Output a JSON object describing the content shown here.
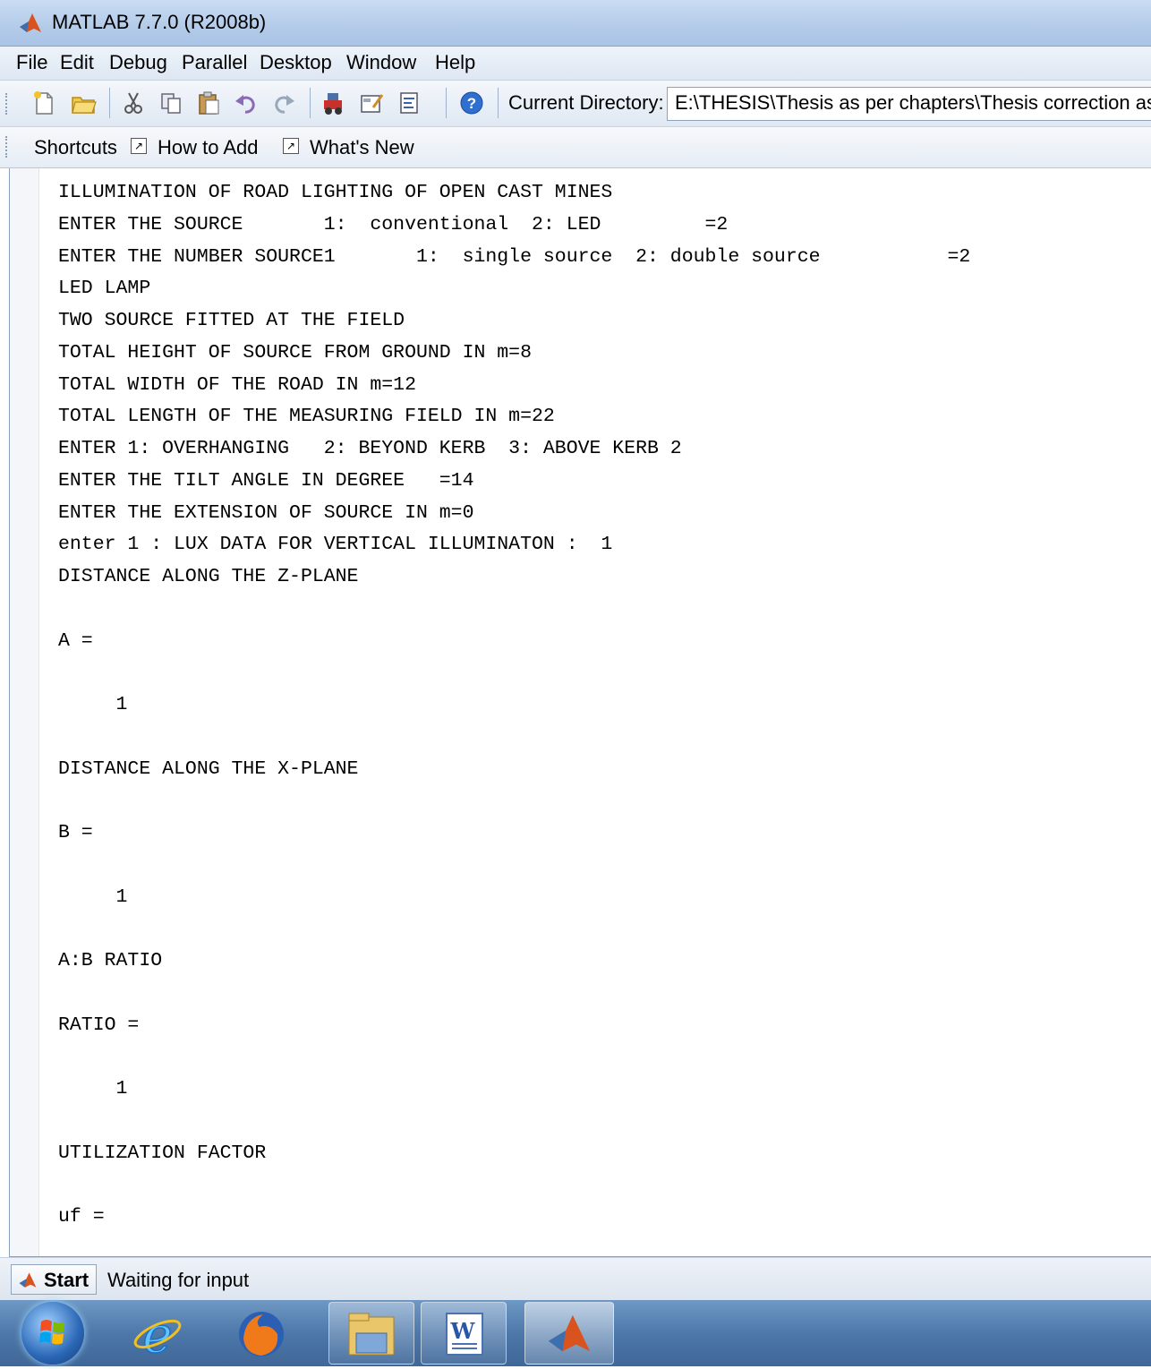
{
  "window": {
    "title": "MATLAB 7.7.0 (R2008b)"
  },
  "menu": [
    "File",
    "Edit",
    "Debug",
    "Parallel",
    "Desktop",
    "Window",
    "Help"
  ],
  "toolbar": {
    "current_directory_label": "Current Directory:",
    "current_directory_value": "E:\\THESIS\\Thesis as per chapters\\Thesis correction as"
  },
  "shortcuts": {
    "label": "Shortcuts",
    "how_to_add": "How to Add",
    "whats_new": "What's New"
  },
  "command_window": {
    "lines": [
      "ILLUMINATION OF ROAD LIGHTING OF OPEN CAST MINES",
      "ENTER THE SOURCE       1:  conventional  2: LED         =2",
      "ENTER THE NUMBER SOURCE1       1:  single source  2: double source           =2",
      "LED LAMP",
      "TWO SOURCE FITTED AT THE FIELD",
      "TOTAL HEIGHT OF SOURCE FROM GROUND IN m=8",
      "TOTAL WIDTH OF THE ROAD IN m=12",
      "TOTAL LENGTH OF THE MEASURING FIELD IN m=22",
      "ENTER 1: OVERHANGING   2: BEYOND KERB  3: ABOVE KERB 2",
      "ENTER THE TILT ANGLE IN DEGREE   =14",
      "ENTER THE EXTENSION OF SOURCE IN m=0",
      "enter 1 : LUX DATA FOR VERTICAL ILLUMINATON :  1",
      "DISTANCE ALONG THE Z-PLANE",
      "",
      "A =",
      "",
      "     1",
      "",
      "DISTANCE ALONG THE X-PLANE",
      "",
      "B =",
      "",
      "     1",
      "",
      "A:B RATIO",
      "",
      "RATIO =",
      "",
      "     1",
      "",
      "UTILIZATION FACTOR",
      "",
      "uf ="
    ]
  },
  "status": {
    "start_label": "Start",
    "text": "Waiting for input"
  },
  "taskbar": {
    "items": [
      "windows-start-orb",
      "internet-explorer-icon",
      "firefox-icon",
      "file-explorer-icon",
      "word-icon",
      "matlab-icon"
    ]
  },
  "colors": {
    "title_bar": "#b3cbe9",
    "taskbar": "#4d78a9",
    "matlab_orange": "#d9531e"
  }
}
